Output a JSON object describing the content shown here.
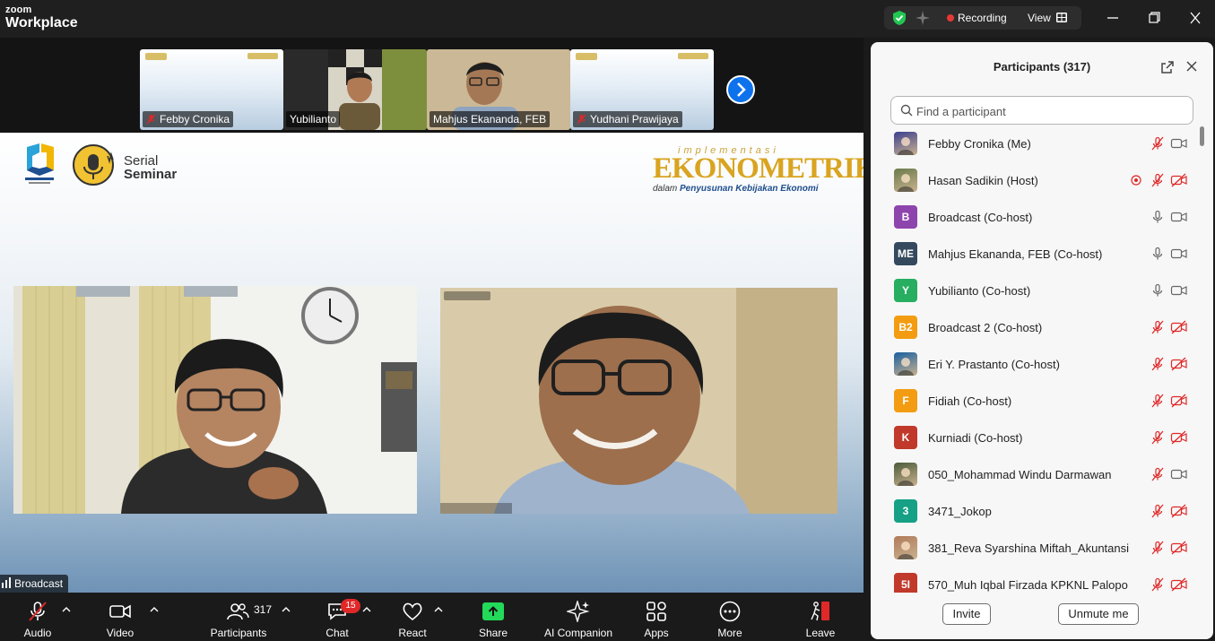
{
  "app": {
    "logo_line1": "zoom",
    "logo_line2": "Workplace"
  },
  "titlebar": {
    "recording_label": "Recording",
    "view_label": "View"
  },
  "thumbnails": [
    {
      "name": "Febby Cronika",
      "muted": true
    },
    {
      "name": "Yubilianto",
      "muted": false
    },
    {
      "name": "Mahjus Ekananda, FEB",
      "muted": false
    },
    {
      "name": "Yudhani Prawijaya",
      "muted": true
    }
  ],
  "slide": {
    "serial_line1": "Serial",
    "serial_line2": "Seminar",
    "title_small": "implementasi",
    "title_main": "EKONOMETRIKA",
    "subtitle_prefix": "dalam ",
    "subtitle_bold": "Penyusunan Kebijakan Ekonomi"
  },
  "main_speaker_tag": "Broadcast",
  "toolbar": {
    "audio": "Audio",
    "video": "Video",
    "participants": "Participants",
    "participants_count": "317",
    "chat": "Chat",
    "chat_badge": "15",
    "react": "React",
    "share": "Share",
    "ai_companion": "AI Companion",
    "apps": "Apps",
    "more": "More",
    "leave": "Leave"
  },
  "panel": {
    "title": "Participants (317)",
    "search_placeholder": "Find a participant",
    "invite": "Invite",
    "unmute_me": "Unmute me",
    "participants": [
      {
        "name": "Febby Cronika (Me)",
        "avatar": "",
        "avatar_color": "#3b3f8f",
        "photo": true,
        "mic": "muted",
        "cam": "on",
        "rec": false
      },
      {
        "name": "Hasan Sadikin (Host)",
        "avatar": "",
        "avatar_color": "#6a7a4a",
        "photo": true,
        "mic": "muted",
        "cam": "off",
        "rec": true
      },
      {
        "name": "Broadcast (Co-host)",
        "avatar": "B",
        "avatar_color": "#8e44ad",
        "photo": false,
        "mic": "on",
        "cam": "on",
        "rec": false
      },
      {
        "name": "Mahjus Ekananda, FEB (Co-host)",
        "avatar": "ME",
        "avatar_color": "#34495e",
        "photo": false,
        "mic": "on",
        "cam": "on",
        "rec": false
      },
      {
        "name": "Yubilianto (Co-host)",
        "avatar": "Y",
        "avatar_color": "#27ae60",
        "photo": false,
        "mic": "on",
        "cam": "on",
        "rec": false
      },
      {
        "name": "Broadcast 2 (Co-host)",
        "avatar": "B2",
        "avatar_color": "#f39c12",
        "photo": false,
        "mic": "muted",
        "cam": "off",
        "rec": false
      },
      {
        "name": "Eri Y. Prastanto (Co-host)",
        "avatar": "",
        "avatar_color": "#1a5fa0",
        "photo": true,
        "mic": "muted",
        "cam": "off",
        "rec": false
      },
      {
        "name": "Fidiah (Co-host)",
        "avatar": "F",
        "avatar_color": "#f39c12",
        "photo": false,
        "mic": "muted",
        "cam": "off",
        "rec": false
      },
      {
        "name": "Kurniadi (Co-host)",
        "avatar": "K",
        "avatar_color": "#c0392b",
        "photo": false,
        "mic": "muted",
        "cam": "off",
        "rec": false
      },
      {
        "name": "050_Mohammad Windu Darmawan",
        "avatar": "",
        "avatar_color": "#4a5a3a",
        "photo": true,
        "mic": "muted",
        "cam": "on",
        "rec": false
      },
      {
        "name": "3471_Jokop",
        "avatar": "3",
        "avatar_color": "#16a085",
        "photo": false,
        "mic": "muted",
        "cam": "off",
        "rec": false
      },
      {
        "name": "381_Reva Syarshina Miftah_Akuntansi",
        "avatar": "",
        "avatar_color": "#b07a5a",
        "photo": true,
        "mic": "muted",
        "cam": "off",
        "rec": false
      },
      {
        "name": "570_Muh Iqbal Firzada KPKNL Palopo",
        "avatar": "5I",
        "avatar_color": "#c0392b",
        "photo": false,
        "mic": "muted",
        "cam": "off",
        "rec": false
      }
    ]
  },
  "colors": {
    "accent": "#0e72ed",
    "muted_red": "#e02828",
    "share_green": "#23d959",
    "badge_red": "#e02828"
  }
}
